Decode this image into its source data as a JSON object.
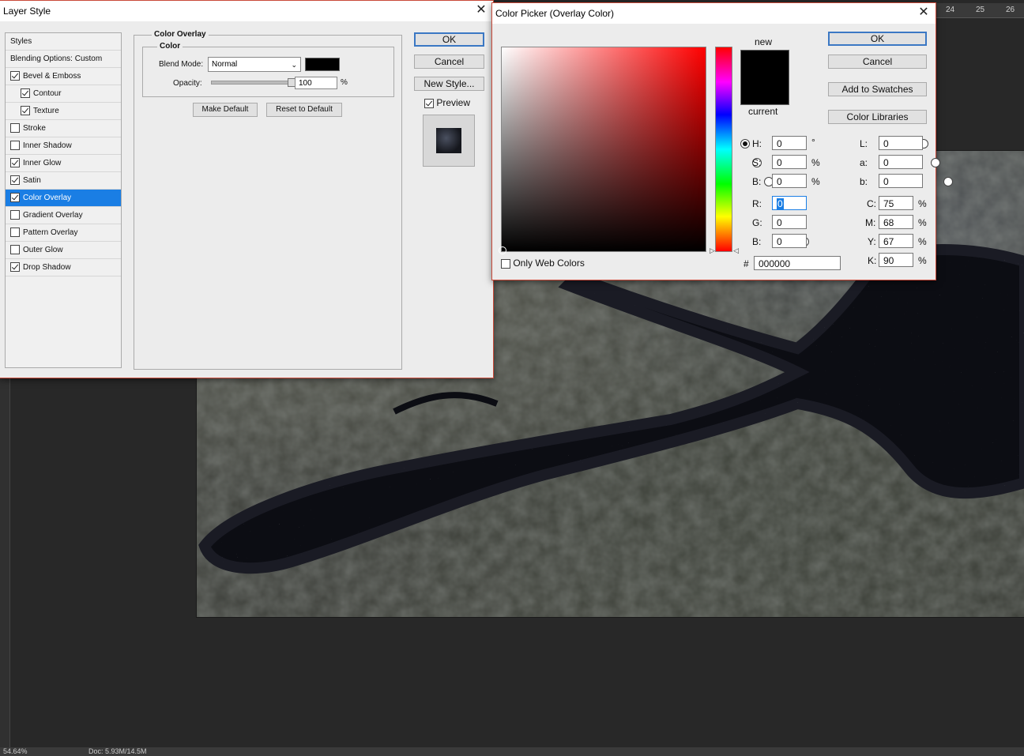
{
  "colors": {
    "accent": "#1a7ee4",
    "dialog_border": "#c94a3a",
    "overlay_color": "#000000"
  },
  "ruler": {
    "top_labels": [
      "24",
      "25",
      "26"
    ]
  },
  "statusbar": {
    "zoom": "54.64%",
    "doc": "Doc: 5.93M/14.5M"
  },
  "layer_style": {
    "title": "Layer Style",
    "styles_header": "Styles",
    "blending_options": "Blending Options: Custom",
    "items": [
      {
        "label": "Bevel & Emboss",
        "checked": true
      },
      {
        "label": "Contour",
        "checked": true,
        "indent": true
      },
      {
        "label": "Texture",
        "checked": true,
        "indent": true
      },
      {
        "label": "Stroke",
        "checked": false
      },
      {
        "label": "Inner Shadow",
        "checked": false
      },
      {
        "label": "Inner Glow",
        "checked": true
      },
      {
        "label": "Satin",
        "checked": true
      },
      {
        "label": "Color Overlay",
        "checked": true,
        "selected": true
      },
      {
        "label": "Gradient Overlay",
        "checked": false
      },
      {
        "label": "Pattern Overlay",
        "checked": false
      },
      {
        "label": "Outer Glow",
        "checked": false
      },
      {
        "label": "Drop Shadow",
        "checked": true
      }
    ],
    "section_title": "Color Overlay",
    "group_title": "Color",
    "blend_mode_label": "Blend Mode:",
    "blend_mode_value": "Normal",
    "opacity_label": "Opacity:",
    "opacity_value": "100",
    "opacity_unit": "%",
    "make_default": "Make Default",
    "reset_default": "Reset to Default",
    "ok": "OK",
    "cancel": "Cancel",
    "new_style": "New Style...",
    "preview_label": "Preview"
  },
  "color_picker": {
    "title": "Color Picker (Overlay Color)",
    "new_label": "new",
    "current_label": "current",
    "ok": "OK",
    "cancel": "Cancel",
    "add_swatches": "Add to Swatches",
    "color_libraries": "Color Libraries",
    "only_web_colors": "Only Web Colors",
    "hsb": [
      {
        "label": "H:",
        "value": "0",
        "unit": "°"
      },
      {
        "label": "S:",
        "value": "0",
        "unit": "%"
      },
      {
        "label": "B:",
        "value": "0",
        "unit": "%"
      }
    ],
    "rgb": [
      {
        "label": "R:",
        "value": "0"
      },
      {
        "label": "G:",
        "value": "0"
      },
      {
        "label": "B:",
        "value": "0"
      }
    ],
    "lab": [
      {
        "label": "L:",
        "value": "0"
      },
      {
        "label": "a:",
        "value": "0"
      },
      {
        "label": "b:",
        "value": "0"
      }
    ],
    "cmyk": [
      {
        "label": "C:",
        "value": "75",
        "unit": "%"
      },
      {
        "label": "M:",
        "value": "68",
        "unit": "%"
      },
      {
        "label": "Y:",
        "value": "67",
        "unit": "%"
      },
      {
        "label": "K:",
        "value": "90",
        "unit": "%"
      }
    ],
    "hex_label": "#",
    "hex_value": "000000"
  }
}
